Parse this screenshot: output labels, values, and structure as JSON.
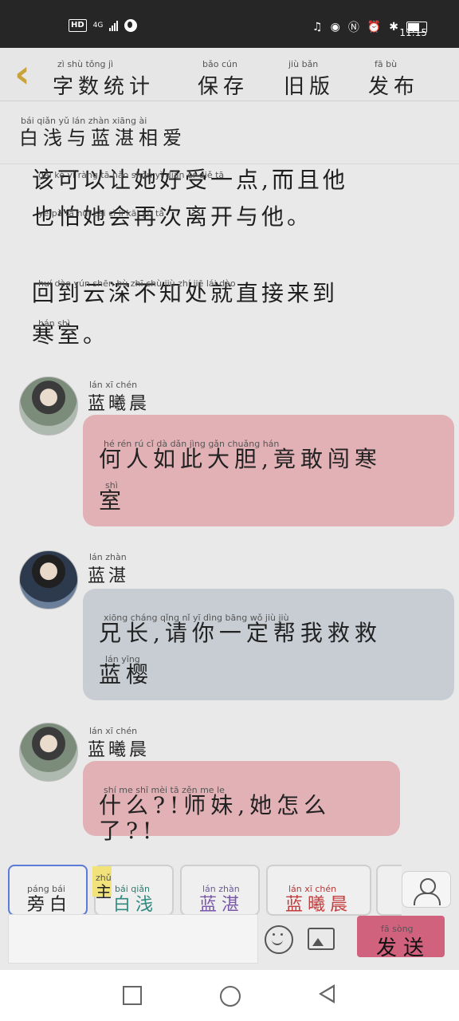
{
  "status": {
    "hd": "HD",
    "net": "4G",
    "time": "11:15"
  },
  "toolbar": {
    "stats_label": "字数统计",
    "stats_pinyin": "zì shù tǒng jì",
    "save_label": "保存",
    "save_pinyin": "bǎo cún",
    "old_label": "旧版",
    "old_pinyin": "jiù bǎn",
    "publish_label": "发布",
    "publish_pinyin": "fā bù"
  },
  "title": {
    "text": "白浅与蓝湛相爱",
    "pinyin": "bái qiǎn yǔ lán zhàn xiāng ài"
  },
  "story": {
    "partial_pinyin": "gāi kě yǐ ràng tā hǎo shòu yì diǎn ér qiě tā",
    "line1": "该可以让她好受一点,而且他",
    "line2_pinyin": "yě pà tā huì zài cì lí kāi yǔ tā",
    "line2": "也怕她会再次离开与他。",
    "p2_pinyin": "huí dào yún shēn bù zhī chù jiù zhí jiē lái dào",
    "p2_line1": "回到云深不知处就直接来到",
    "p2_pinyin2": "hán shì",
    "p2_line2": "寒室。"
  },
  "messages": [
    {
      "name": "蓝曦晨",
      "name_pinyin": "lán xī chén",
      "pinyin1": "hé rén rú cǐ dà dǎn jìng gǎn chuǎng hán",
      "text1": "何人如此大胆,竟敢闯寒",
      "pinyin2": "shì",
      "text2": "室"
    },
    {
      "name": "蓝湛",
      "name_pinyin": "lán zhàn",
      "pinyin1": "xiōng cháng qǐng nǐ yī dìng bāng wǒ jiù jiù",
      "text1": "兄长,请你一定帮我救救",
      "pinyin2": "lán yīng",
      "text2": "蓝樱"
    },
    {
      "name": "蓝曦晨",
      "name_pinyin": "lán xī chén",
      "pinyin1": "shí me shī mèi tā zěn me le",
      "text1": "什么?!师妹,她怎么了?!"
    }
  ],
  "chips": [
    {
      "label": "旁白",
      "pinyin": "páng bái"
    },
    {
      "badge": "主",
      "badge_pinyin": "zhǔ",
      "label": "白浅",
      "pinyin": "bái qiǎn"
    },
    {
      "label": "蓝湛",
      "pinyin": "lán zhàn"
    },
    {
      "label": "蓝曦晨",
      "pinyin": "lán xī chén"
    }
  ],
  "send": {
    "label": "发送",
    "pinyin": "fā sòng"
  },
  "colors": {
    "pink_bubble": "#e2b1b5",
    "blue_bubble": "#c8cdd4",
    "send_button": "#d1627e",
    "back_arrow": "#c9a23a",
    "selected_chip_border": "#5b7bd6"
  }
}
